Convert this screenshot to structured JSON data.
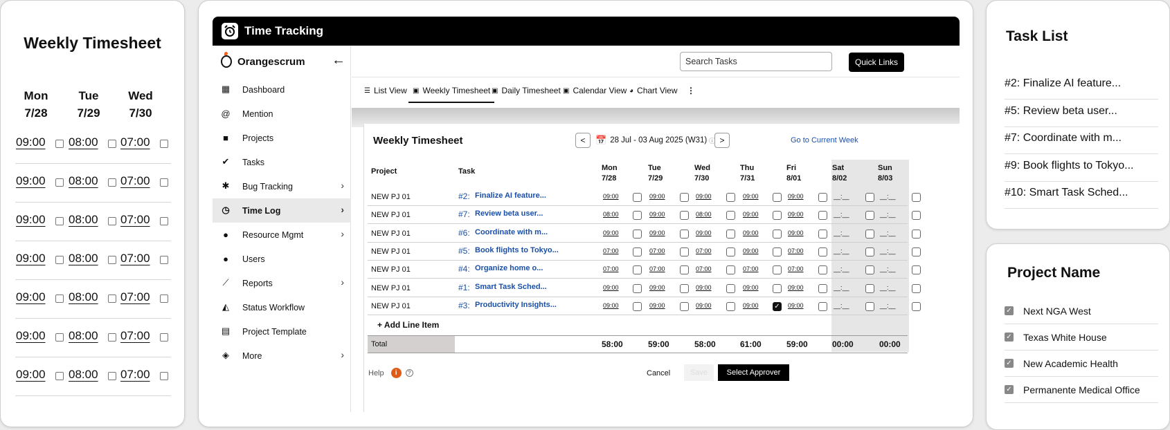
{
  "left_card": {
    "title": "Weekly Timesheet",
    "days": [
      {
        "day": "Mon",
        "date": "7/28"
      },
      {
        "day": "Tue",
        "date": "7/29"
      },
      {
        "day": "Wed",
        "date": "7/30"
      }
    ],
    "rows": [
      [
        "09:00",
        "08:00",
        "07:00"
      ],
      [
        "09:00",
        "08:00",
        "07:00"
      ],
      [
        "09:00",
        "08:00",
        "07:00"
      ],
      [
        "09:00",
        "08:00",
        "07:00"
      ],
      [
        "09:00",
        "08:00",
        "07:00"
      ],
      [
        "09:00",
        "08:00",
        "07:00"
      ],
      [
        "09:00",
        "08:00",
        "07:00"
      ]
    ]
  },
  "app": {
    "title": "Time Tracking",
    "logo": "Orangescrum",
    "search_placeholder": "Search Tasks",
    "quick_links": "Quick Links",
    "menu": [
      {
        "label": "Dashboard",
        "icon": "dashboard-icon",
        "glyph": "▦",
        "chevron": false
      },
      {
        "label": "Mention",
        "icon": "at-icon",
        "glyph": "@",
        "chevron": false
      },
      {
        "label": "Projects",
        "icon": "briefcase-icon",
        "glyph": "■",
        "chevron": false
      },
      {
        "label": "Tasks",
        "icon": "clipboard-check-icon",
        "glyph": "✔",
        "chevron": false
      },
      {
        "label": "Bug Tracking",
        "icon": "bug-icon",
        "glyph": "✱",
        "chevron": true
      },
      {
        "label": "Time Log",
        "icon": "clock-icon",
        "glyph": "◷",
        "chevron": true,
        "active": true
      },
      {
        "label": "Resource Mgmt",
        "icon": "palette-icon",
        "glyph": "●",
        "chevron": true
      },
      {
        "label": "Users",
        "icon": "user-icon",
        "glyph": "●",
        "chevron": false
      },
      {
        "label": "Reports",
        "icon": "trend-icon",
        "glyph": "⟋",
        "chevron": true
      },
      {
        "label": "Status Workflow",
        "icon": "workflow-icon",
        "glyph": "◭",
        "chevron": false
      },
      {
        "label": "Project Template",
        "icon": "document-icon",
        "glyph": "▤",
        "chevron": false
      },
      {
        "label": "More",
        "icon": "layers-icon",
        "glyph": "◈",
        "chevron": true
      }
    ],
    "tabs": [
      {
        "label": "List View",
        "glyph": "☰"
      },
      {
        "label": "Weekly Timesheet",
        "glyph": "▣",
        "active": true
      },
      {
        "label": "Daily Timesheet",
        "glyph": "▣"
      },
      {
        "label": "Calendar View",
        "glyph": "▣"
      },
      {
        "label": "Chart View",
        "glyph": "◕"
      }
    ],
    "more_tabs_glyph": "⋮",
    "timesheet": {
      "title": "Weekly Timesheet",
      "prev_glyph": "<",
      "next_glyph": ">",
      "date_range": "28 Jul - 03 Aug 2025 (W31)",
      "go_current": "Go to Current Week",
      "col_project": "Project",
      "col_task": "Task",
      "day_cols": [
        {
          "day": "Mon",
          "date": "7/28"
        },
        {
          "day": "Tue",
          "date": "7/29"
        },
        {
          "day": "Wed",
          "date": "7/30"
        },
        {
          "day": "Thu",
          "date": "7/31"
        },
        {
          "day": "Fri",
          "date": "8/01"
        },
        {
          "day": "Sat",
          "date": "8/02"
        },
        {
          "day": "Sun",
          "date": "8/03"
        }
      ],
      "rows": [
        {
          "project": "NEW PJ 01",
          "num": "#2:",
          "task": "Finalize AI feature...",
          "times": [
            "09:00",
            "09:00",
            "09:00",
            "09:00",
            "09:00"
          ],
          "checked": [
            false,
            false,
            false,
            false,
            false,
            false,
            false
          ]
        },
        {
          "project": "NEW PJ 01",
          "num": "#7:",
          "task": "Review beta user...",
          "times": [
            "08:00",
            "09:00",
            "08:00",
            "09:00",
            "09:00"
          ],
          "checked": [
            false,
            false,
            false,
            false,
            false,
            false,
            false
          ]
        },
        {
          "project": "NEW PJ 01",
          "num": "#6:",
          "task": "Coordinate with m...",
          "times": [
            "09:00",
            "09:00",
            "09:00",
            "09:00",
            "09:00"
          ],
          "checked": [
            false,
            false,
            false,
            false,
            false,
            false,
            false
          ]
        },
        {
          "project": "NEW PJ 01",
          "num": "#5:",
          "task": "Book flights to Tokyo...",
          "times": [
            "07:00",
            "07:00",
            "07:00",
            "09:00",
            "07:00"
          ],
          "checked": [
            false,
            false,
            false,
            false,
            false,
            false,
            false
          ]
        },
        {
          "project": "NEW PJ 01",
          "num": "#4:",
          "task": "Organize home o...",
          "times": [
            "07:00",
            "07:00",
            "07:00",
            "07:00",
            "07:00"
          ],
          "checked": [
            false,
            false,
            false,
            false,
            false,
            false,
            false
          ]
        },
        {
          "project": "NEW PJ 01",
          "num": "#1:",
          "task": "Smart Task Sched...",
          "times": [
            "09:00",
            "09:00",
            "09:00",
            "09:00",
            "09:00"
          ],
          "checked": [
            false,
            false,
            false,
            false,
            false,
            false,
            false
          ]
        },
        {
          "project": "NEW PJ 01",
          "num": "#3:",
          "task": "Productivity Insights...",
          "times": [
            "09:00",
            "09:00",
            "09:00",
            "09:00",
            "09:00"
          ],
          "checked": [
            false,
            false,
            false,
            true,
            false,
            false,
            false
          ]
        }
      ],
      "weekend_placeholder": "__:__",
      "add_line": "+ Add Line Item",
      "total_label": "Total",
      "totals": [
        "58:00",
        "59:00",
        "58:00",
        "61:00",
        "59:00",
        "00:00",
        "00:00"
      ],
      "help": "Help",
      "info_glyph": "i",
      "help_glyph": "?",
      "cancel": "Cancel",
      "save": "Save",
      "select_approver": "Select Approver"
    }
  },
  "task_list": {
    "title": "Task List",
    "items": [
      {
        "num": "#2:",
        "name": "Finalize AI feature..."
      },
      {
        "num": "#5:",
        "name": "Review beta user..."
      },
      {
        "num": "#7:",
        "name": "Coordinate with m..."
      },
      {
        "num": "#9:",
        "name": "Book flights to Tokyo..."
      },
      {
        "num": "#10:",
        "name": "Smart Task Sched..."
      }
    ]
  },
  "project_names": {
    "title": "Project Name",
    "items": [
      "Next NGA West",
      "Texas White House",
      "New Academic Health",
      "Permanente Medical Office"
    ]
  }
}
